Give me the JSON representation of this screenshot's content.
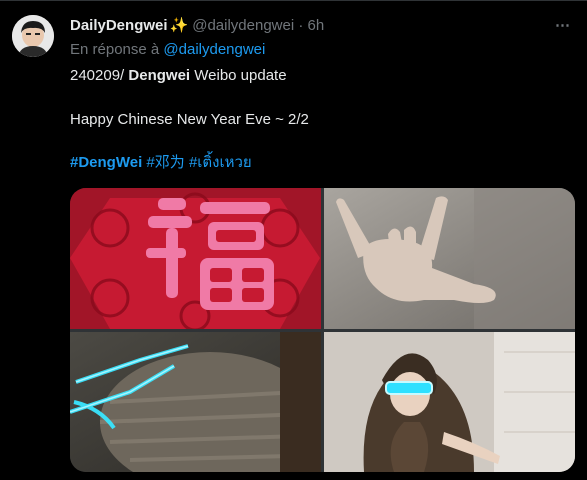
{
  "tweet": {
    "display_name": "DailyDengwei",
    "name_emoji": "✨",
    "handle": "@dailydengwei",
    "separator": "·",
    "time": "6h",
    "more_icon": "⋯",
    "reply_prefix": "En réponse à",
    "reply_mention": "@dailydengwei",
    "line1_prefix": "240209/",
    "line1_bold": "Dengwei",
    "line1_suffix": "Weibo update",
    "line2": "Happy Chinese New Year Eve ~ 2/2",
    "hashtag_1": "#DengWei",
    "hashtag_2": "#邓为",
    "hashtag_3": "#เติ้งเหวย"
  },
  "media": {
    "images": [
      {
        "subject": "red paper-cut fu decoration"
      },
      {
        "subject": "hand making rock gesture"
      },
      {
        "subject": "cyan LED glasses over knitted sweater"
      },
      {
        "subject": "person in hooded jacket with LED glasses"
      }
    ]
  }
}
